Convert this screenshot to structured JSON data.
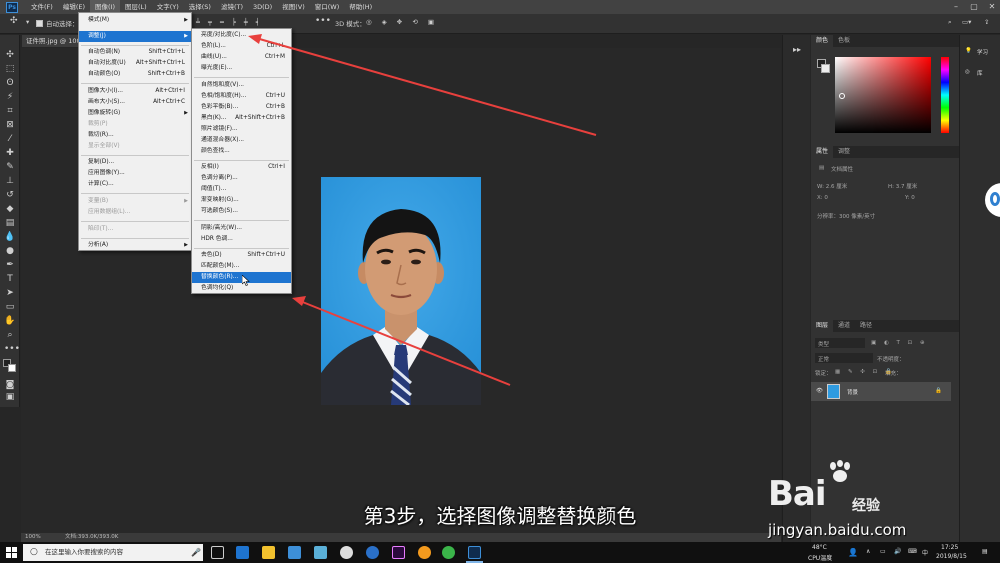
{
  "menubar": {
    "items": [
      "文件(F)",
      "编辑(E)",
      "图像(I)",
      "图层(L)",
      "文字(Y)",
      "选择(S)",
      "滤镜(T)",
      "3D(D)",
      "视图(V)",
      "窗口(W)",
      "帮助(H)"
    ]
  },
  "options_bar": {
    "auto_select": "自动选择：",
    "mode": "3D 模式："
  },
  "document": {
    "tab_title": "证件照.jpg @ 100",
    "zoom": "100%",
    "doc_size": "文档:393.0K/393.0K"
  },
  "image_menu": {
    "items": [
      {
        "label": "模式(M)",
        "shortcut": "",
        "submenu": true,
        "disabled": false
      },
      {
        "label": "调整(J)",
        "shortcut": "",
        "submenu": true,
        "disabled": false,
        "active": true
      },
      {
        "label": "自动色调(N)",
        "shortcut": "Shift+Ctrl+L",
        "disabled": false
      },
      {
        "label": "自动对比度(U)",
        "shortcut": "Alt+Shift+Ctrl+L",
        "disabled": false
      },
      {
        "label": "自动颜色(O)",
        "shortcut": "Shift+Ctrl+B",
        "disabled": false
      },
      {
        "label": "图像大小(I)...",
        "shortcut": "Alt+Ctrl+I",
        "disabled": false
      },
      {
        "label": "画布大小(S)...",
        "shortcut": "Alt+Ctrl+C",
        "disabled": false
      },
      {
        "label": "图像旋转(G)",
        "shortcut": "",
        "submenu": true,
        "disabled": false
      },
      {
        "label": "裁剪(P)",
        "shortcut": "",
        "disabled": true
      },
      {
        "label": "裁切(R)...",
        "shortcut": "",
        "disabled": false
      },
      {
        "label": "显示全部(V)",
        "shortcut": "",
        "disabled": true
      },
      {
        "label": "复制(D)...",
        "shortcut": "",
        "disabled": false
      },
      {
        "label": "应用图像(Y)...",
        "shortcut": "",
        "disabled": false
      },
      {
        "label": "计算(C)...",
        "shortcut": "",
        "disabled": false
      },
      {
        "label": "变量(B)",
        "shortcut": "",
        "submenu": true,
        "disabled": true
      },
      {
        "label": "应用数据组(L)...",
        "shortcut": "",
        "disabled": true
      },
      {
        "label": "陷印(T)...",
        "shortcut": "",
        "disabled": true
      },
      {
        "label": "分析(A)",
        "shortcut": "",
        "submenu": true,
        "disabled": false
      }
    ]
  },
  "adjust_menu": {
    "items": [
      {
        "label": "亮度/对比度(C)...",
        "shortcut": ""
      },
      {
        "label": "色阶(L)...",
        "shortcut": "Ctrl+L"
      },
      {
        "label": "曲线(U)...",
        "shortcut": "Ctrl+M"
      },
      {
        "label": "曝光度(E)...",
        "shortcut": ""
      },
      {
        "label": "自然饱和度(V)...",
        "shortcut": ""
      },
      {
        "label": "色相/饱和度(H)...",
        "shortcut": "Ctrl+U"
      },
      {
        "label": "色彩平衡(B)...",
        "shortcut": "Ctrl+B"
      },
      {
        "label": "黑白(K)...",
        "shortcut": "Alt+Shift+Ctrl+B"
      },
      {
        "label": "照片滤镜(F)...",
        "shortcut": ""
      },
      {
        "label": "通道混合器(X)...",
        "shortcut": ""
      },
      {
        "label": "颜色查找...",
        "shortcut": ""
      },
      {
        "label": "反相(I)",
        "shortcut": "Ctrl+I"
      },
      {
        "label": "色调分离(P)...",
        "shortcut": ""
      },
      {
        "label": "阈值(T)...",
        "shortcut": ""
      },
      {
        "label": "渐变映射(G)...",
        "shortcut": ""
      },
      {
        "label": "可选颜色(S)...",
        "shortcut": ""
      },
      {
        "label": "阴影/高光(W)...",
        "shortcut": ""
      },
      {
        "label": "HDR 色调...",
        "shortcut": ""
      },
      {
        "label": "去色(D)",
        "shortcut": "Shift+Ctrl+U"
      },
      {
        "label": "匹配颜色(M)...",
        "shortcut": ""
      },
      {
        "label": "替换颜色(R)...",
        "shortcut": "",
        "highlight": true
      },
      {
        "label": "色调均化(Q)",
        "shortcut": ""
      }
    ]
  },
  "panels": {
    "color_tabs": [
      "颜色",
      "色板"
    ],
    "properties_tabs": [
      "属性",
      "调整"
    ],
    "doc_props": "文档属性",
    "w_label": "W: 2.6 厘米",
    "h_label": "H: 3.7 厘米",
    "x_label": "X: 0",
    "y_label": "Y: 0",
    "resolution": "分辨率：300 像素/英寸",
    "layers_tabs": [
      "图层",
      "通道",
      "路径"
    ],
    "kind": "类型",
    "blend": "正常",
    "opacity": "不透明度：",
    "lock": "锁定：",
    "fill": "填充：",
    "layer_name": "背景",
    "learn": "学习",
    "libraries": "库"
  },
  "subtitle": "第3步，选择图像调整替换颜色",
  "watermark": {
    "main": "Bai",
    "sub": "经验",
    "url": "jingyan.baidu.com"
  },
  "taskbar": {
    "search_placeholder": "在这里输入你要搜索的内容",
    "temp": "48°C",
    "cpu": "CPU温度",
    "time": "17:25",
    "date": "2019/8/15",
    "tray_lang": "中"
  },
  "colors": {
    "accent": "#1e74d0",
    "arrow": "#e8403d",
    "photo_bg": "#2f9be0"
  }
}
